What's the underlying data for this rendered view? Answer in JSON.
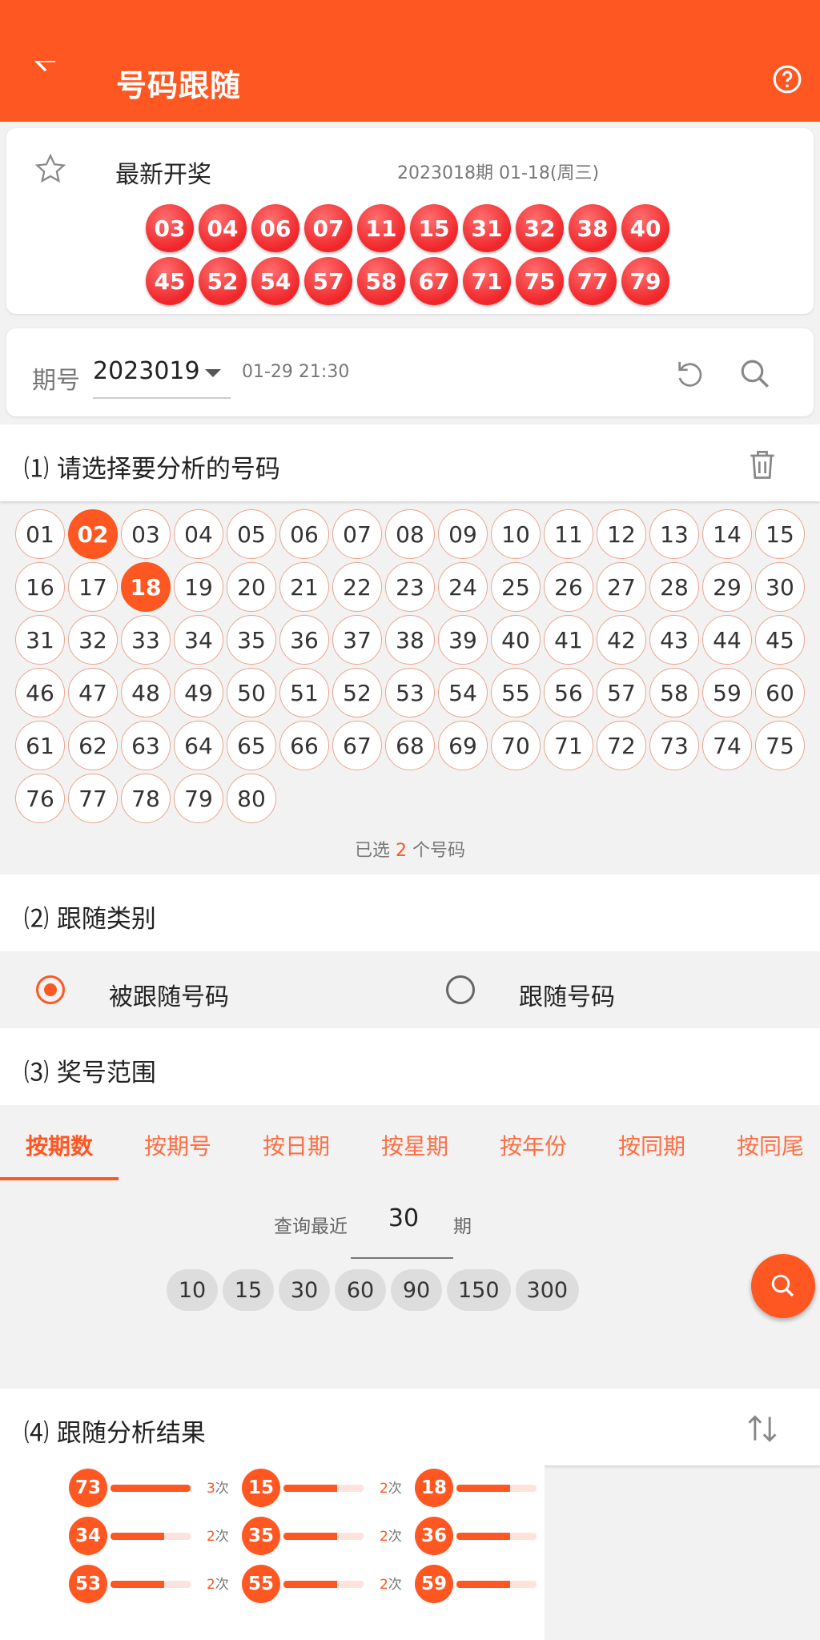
{
  "app_bar": {
    "title": "号码跟随",
    "back_icon": "arrow-left-icon",
    "help_icon": "help-circle-icon"
  },
  "latest_draw": {
    "label": "最新开奖",
    "info": "2023018期  01-18(周三)",
    "numbers": [
      "03",
      "04",
      "06",
      "07",
      "11",
      "15",
      "31",
      "32",
      "38",
      "40",
      "45",
      "52",
      "54",
      "57",
      "58",
      "67",
      "71",
      "75",
      "77",
      "79"
    ]
  },
  "issue": {
    "label": "期号",
    "value": "2023019",
    "time": "01-29 21:30"
  },
  "section1": {
    "title": "⑴ 请选择要分析的号码"
  },
  "numbers": {
    "all": [
      "01",
      "02",
      "03",
      "04",
      "05",
      "06",
      "07",
      "08",
      "09",
      "10",
      "11",
      "12",
      "13",
      "14",
      "15",
      "16",
      "17",
      "18",
      "19",
      "20",
      "21",
      "22",
      "23",
      "24",
      "25",
      "26",
      "27",
      "28",
      "29",
      "30",
      "31",
      "32",
      "33",
      "34",
      "35",
      "36",
      "37",
      "38",
      "39",
      "40",
      "41",
      "42",
      "43",
      "44",
      "45",
      "46",
      "47",
      "48",
      "49",
      "50",
      "51",
      "52",
      "53",
      "54",
      "55",
      "56",
      "57",
      "58",
      "59",
      "60",
      "61",
      "62",
      "63",
      "64",
      "65",
      "66",
      "67",
      "68",
      "69",
      "70",
      "71",
      "72",
      "73",
      "74",
      "75",
      "76",
      "77",
      "78",
      "79",
      "80"
    ],
    "selected": [
      "02",
      "18"
    ],
    "count_prefix": "已选 ",
    "count": "2",
    "count_suffix": " 个号码"
  },
  "section2": {
    "title": "⑵ 跟随类别"
  },
  "follow_type": {
    "option1": "被跟随号码",
    "option2": "跟随号码",
    "selected": "option1"
  },
  "section3": {
    "title": "⑶ 奖号范围"
  },
  "range_tabs": [
    "按期数",
    "按期号",
    "按日期",
    "按星期",
    "按年份",
    "按同期",
    "按同尾"
  ],
  "query": {
    "label": "查询最近",
    "value": "30",
    "unit": "期",
    "presets": [
      "10",
      "15",
      "30",
      "60",
      "90",
      "150",
      "300"
    ]
  },
  "section4": {
    "title": "⑷ 跟随分析结果"
  },
  "results": [
    {
      "number": "73",
      "count": "3",
      "unit": "次",
      "fill": 1.0
    },
    {
      "number": "15",
      "count": "2",
      "unit": "次",
      "fill": 0.67
    },
    {
      "number": "18",
      "count": "",
      "unit": "",
      "fill": 0.67
    },
    {
      "number": "34",
      "count": "2",
      "unit": "次",
      "fill": 0.67
    },
    {
      "number": "35",
      "count": "2",
      "unit": "次",
      "fill": 0.67
    },
    {
      "number": "36",
      "count": "",
      "unit": "",
      "fill": 0.67
    },
    {
      "number": "53",
      "count": "2",
      "unit": "次",
      "fill": 0.67
    },
    {
      "number": "55",
      "count": "2",
      "unit": "次",
      "fill": 0.67
    },
    {
      "number": "59",
      "count": "",
      "unit": "",
      "fill": 0.67
    }
  ],
  "colors": {
    "accent": "#ff5722",
    "ball_red": "#f0262a"
  }
}
